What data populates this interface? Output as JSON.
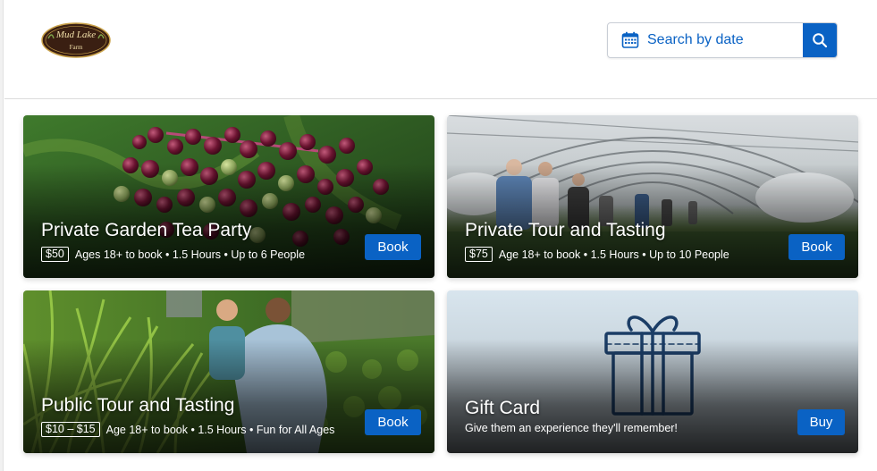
{
  "brand": {
    "name": "Mud Lake",
    "sub": "Farm"
  },
  "search": {
    "label": "Search by date"
  },
  "cards": [
    {
      "title": "Private Garden Tea Party",
      "price": "$50",
      "details": "Ages 18+ to book • 1.5 Hours • Up to 6 People",
      "button": "Book"
    },
    {
      "title": "Private Tour and Tasting",
      "price": "$75",
      "details": "Age 18+ to book • 1.5 Hours • Up to 10 People",
      "button": "Book"
    },
    {
      "title": "Public Tour and Tasting",
      "price": "$10 – $15",
      "details": "Age 18+ to book • 1.5 Hours • Fun for All Ages",
      "button": "Book"
    },
    {
      "title": "Gift Card",
      "details": "Give them an experience they'll remember!",
      "button": "Buy"
    }
  ],
  "colors": {
    "accent": "#0a62c4",
    "logo_bg": "#3a1f12"
  },
  "icons": [
    "calendar-icon",
    "search-icon",
    "gift-icon"
  ]
}
